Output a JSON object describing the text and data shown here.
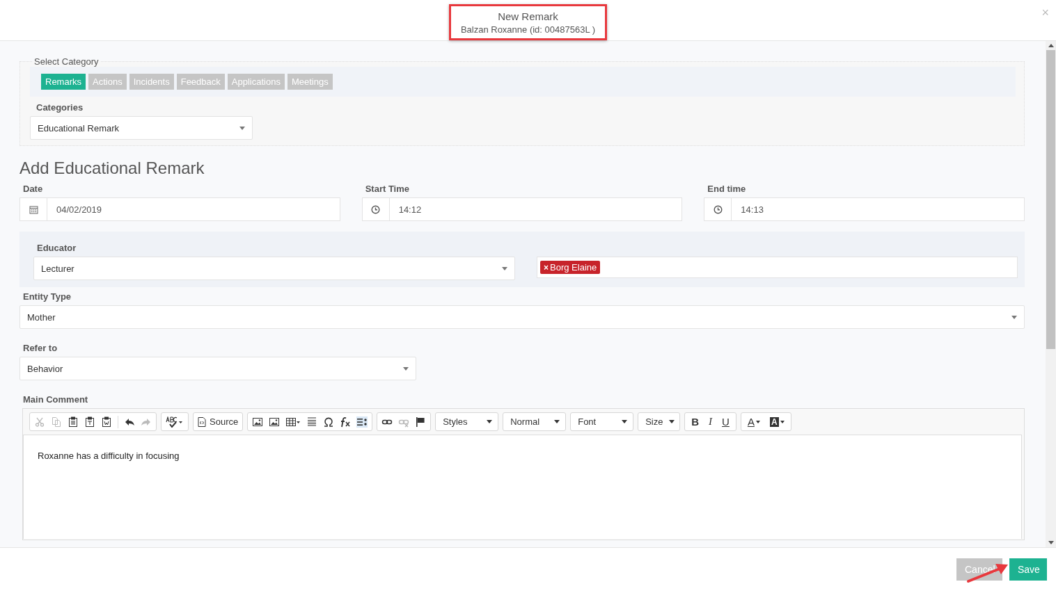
{
  "dialog": {
    "title": "New Remark",
    "subtitle": "Balzan Roxanne (id: 00487563L )",
    "close": "×",
    "title_highlighted": true
  },
  "category_box": {
    "legend": "Select Category",
    "tabs": [
      {
        "label": "Remarks",
        "selected": true
      },
      {
        "label": "Actions",
        "selected": false
      },
      {
        "label": "Incidents",
        "selected": false
      },
      {
        "label": "Feedback",
        "selected": false
      },
      {
        "label": "Applications",
        "selected": false
      },
      {
        "label": "Meetings",
        "selected": false
      }
    ],
    "categories_label": "Categories",
    "categories_value": "Educational Remark"
  },
  "heading": "Add Educational Remark",
  "date": {
    "label": "Date",
    "value": "04/02/2019"
  },
  "start_time": {
    "label": "Start Time",
    "value": "14:12"
  },
  "end_time": {
    "label": "End time",
    "value": "14:13"
  },
  "educator": {
    "label": "Educator",
    "value": "Lecturer",
    "tags": [
      {
        "remove": "×",
        "label": "Borg Elaine"
      }
    ]
  },
  "entity_type": {
    "label": "Entity Type",
    "value": "Mother"
  },
  "refer_to": {
    "label": "Refer to",
    "value": "Behavior"
  },
  "main_comment": {
    "label": "Main Comment",
    "toolbar": {
      "clipboard": [
        {
          "disabled": true
        },
        {
          "disabled": true
        },
        {
          "disabled": false
        },
        {
          "disabled": false
        },
        {
          "disabled": false
        },
        {
          "disabled": false
        },
        {
          "disabled": true
        }
      ],
      "source": "Source",
      "insert": [
        {
          "selected": false
        },
        {
          "selected": false
        },
        {
          "selected": false
        },
        {
          "selected": false
        },
        {
          "selected": false
        },
        {
          "selected": false
        },
        {
          "selected": true
        }
      ],
      "links": [
        {
          "disabled": false
        },
        {
          "disabled": true
        },
        {
          "disabled": false
        }
      ],
      "dropdowns": [
        "Styles",
        "Normal",
        "Font",
        "Size"
      ],
      "format": [
        "B",
        "I",
        "U"
      ],
      "colors": [
        "A",
        "A"
      ]
    },
    "text": "Roxanne has a difficulty in focusing"
  },
  "footer": {
    "cancel": "Cancel",
    "save": "Save",
    "save_arrow": true
  }
}
